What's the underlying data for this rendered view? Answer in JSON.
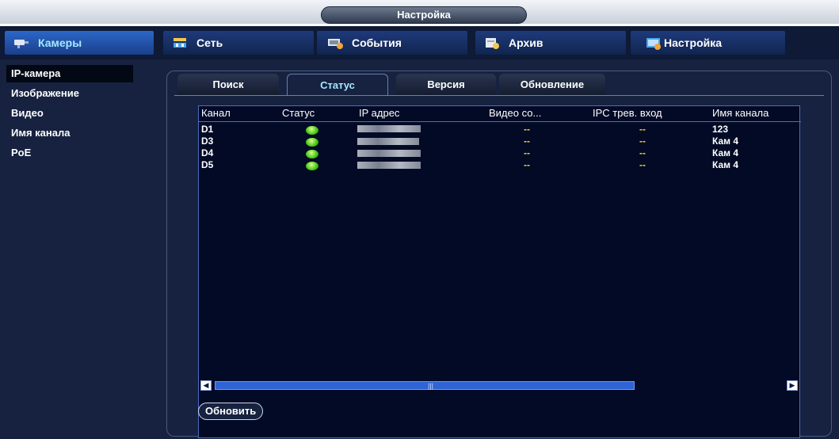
{
  "window": {
    "title": "Настройка"
  },
  "nav": {
    "items": [
      {
        "label": "Камеры",
        "icon": "camera-icon",
        "active": true
      },
      {
        "label": "Сеть",
        "icon": "network-icon",
        "active": false
      },
      {
        "label": "События",
        "icon": "events-icon",
        "active": false
      },
      {
        "label": "Архив",
        "icon": "archive-icon",
        "active": false
      },
      {
        "label": "Настройка",
        "icon": "settings-icon",
        "active": false
      }
    ]
  },
  "sidebar": {
    "items": [
      {
        "label": "IP-камера",
        "active": true
      },
      {
        "label": "Изображение",
        "active": false
      },
      {
        "label": "Видео",
        "active": false
      },
      {
        "label": "Имя канала",
        "active": false
      },
      {
        "label": "PoE",
        "active": false
      }
    ]
  },
  "tabs": [
    {
      "label": "Поиск",
      "active": false
    },
    {
      "label": "Статус",
      "active": true
    },
    {
      "label": "Версия",
      "active": false
    },
    {
      "label": "Обновление",
      "active": false
    }
  ],
  "table": {
    "columns": [
      "Канал",
      "Статус",
      "IP адрес",
      "Видео со...",
      "IPC трев. вход",
      "Имя канала"
    ],
    "rows": [
      {
        "channel": "D1",
        "status": "online",
        "ip": "",
        "video": "--",
        "alarm": "--",
        "name": "123"
      },
      {
        "channel": "D3",
        "status": "online",
        "ip": "",
        "video": "--",
        "alarm": "--",
        "name": "Кам 4"
      },
      {
        "channel": "D4",
        "status": "online",
        "ip": "",
        "video": "--",
        "alarm": "--",
        "name": "Кам 4"
      },
      {
        "channel": "D5",
        "status": "online",
        "ip": "",
        "video": "--",
        "alarm": "--",
        "name": "Кам 4"
      }
    ]
  },
  "actions": {
    "refresh_label": "Обновить"
  },
  "colors": {
    "accent": "#a5e8ff",
    "panel": "#16223f",
    "status_online": "#4ecb1a",
    "dash": "#ffd21c"
  }
}
